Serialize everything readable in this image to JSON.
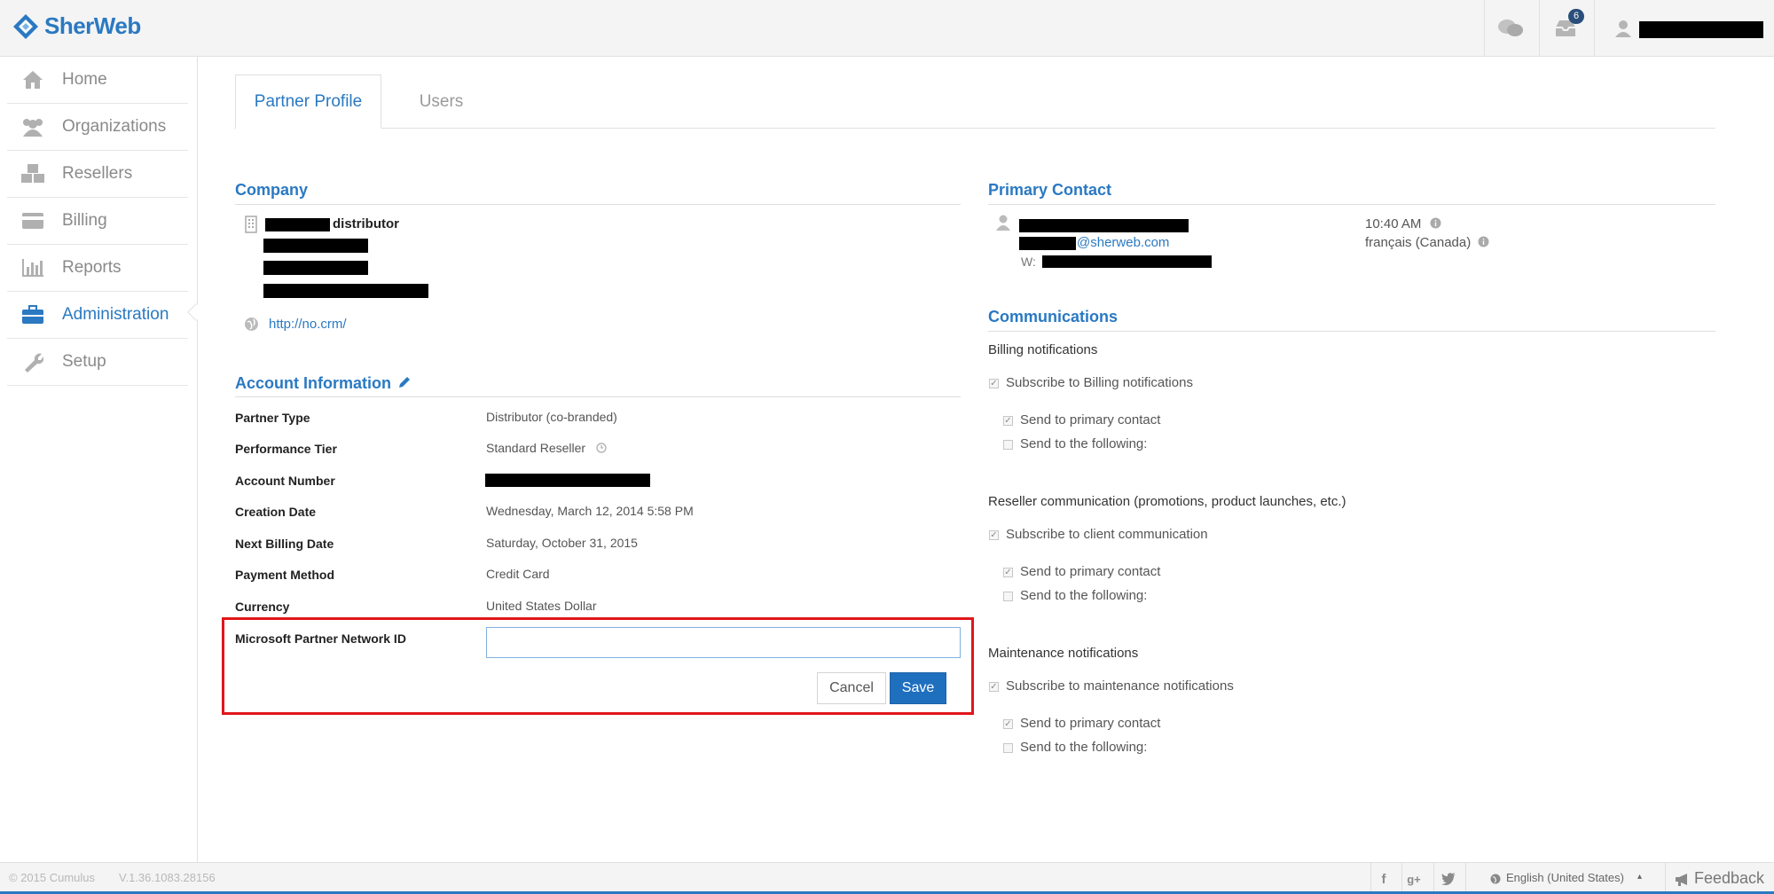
{
  "header": {
    "brand": "SherWeb",
    "notification_count": "6",
    "colors": {
      "brand": "#2a79c2",
      "badge": "#2a4f7a"
    }
  },
  "sidebar": {
    "items": [
      {
        "label": "Home",
        "icon": "home-icon"
      },
      {
        "label": "Organizations",
        "icon": "users-icon"
      },
      {
        "label": "Resellers",
        "icon": "cubes-icon"
      },
      {
        "label": "Billing",
        "icon": "credit-card-icon"
      },
      {
        "label": "Reports",
        "icon": "bar-chart-icon"
      },
      {
        "label": "Administration",
        "icon": "briefcase-icon",
        "active": true
      },
      {
        "label": "Setup",
        "icon": "wrench-icon"
      }
    ]
  },
  "tabs": [
    {
      "label": "Partner Profile",
      "active": true
    },
    {
      "label": "Users",
      "active": false
    }
  ],
  "company": {
    "title": "Company",
    "name_suffix": "distributor",
    "website": "http://no.crm/"
  },
  "account": {
    "title": "Account Information",
    "rows": [
      {
        "label": "Partner Type",
        "value": "Distributor (co-branded)"
      },
      {
        "label": "Performance Tier",
        "value": "Standard Reseller"
      },
      {
        "label": "Account Number",
        "value": ""
      },
      {
        "label": "Creation Date",
        "value": "Wednesday, March 12, 2014 5:58 PM"
      },
      {
        "label": "Next Billing Date",
        "value": "Saturday, October 31, 2015"
      },
      {
        "label": "Payment Method",
        "value": "Credit Card"
      },
      {
        "label": "Currency",
        "value": "United States Dollar"
      }
    ],
    "mpn_label": "Microsoft Partner Network ID",
    "mpn_value": "",
    "cancel_label": "Cancel",
    "save_label": "Save"
  },
  "primary_contact": {
    "title": "Primary Contact",
    "email_domain": "@sherweb.com",
    "phone_prefix": "W:",
    "time": "10:40 AM",
    "locale": "français (Canada)"
  },
  "communications": {
    "title": "Communications",
    "groups": [
      {
        "heading": "Billing notifications",
        "subscribe": "Subscribe to Billing notifications",
        "send_primary": "Send to primary contact",
        "send_following": "Send to the following:"
      },
      {
        "heading": "Reseller communication (promotions, product launches, etc.)",
        "subscribe": "Subscribe to client communication",
        "send_primary": "Send to primary contact",
        "send_following": "Send to the following:"
      },
      {
        "heading": "Maintenance notifications",
        "subscribe": "Subscribe to maintenance notifications",
        "send_primary": "Send to primary contact",
        "send_following": "Send to the following:"
      }
    ]
  },
  "footer": {
    "copyright": "© 2015 Cumulus",
    "version": "V.1.36.1083.28156",
    "language": "English (United States)",
    "feedback": "Feedback"
  }
}
